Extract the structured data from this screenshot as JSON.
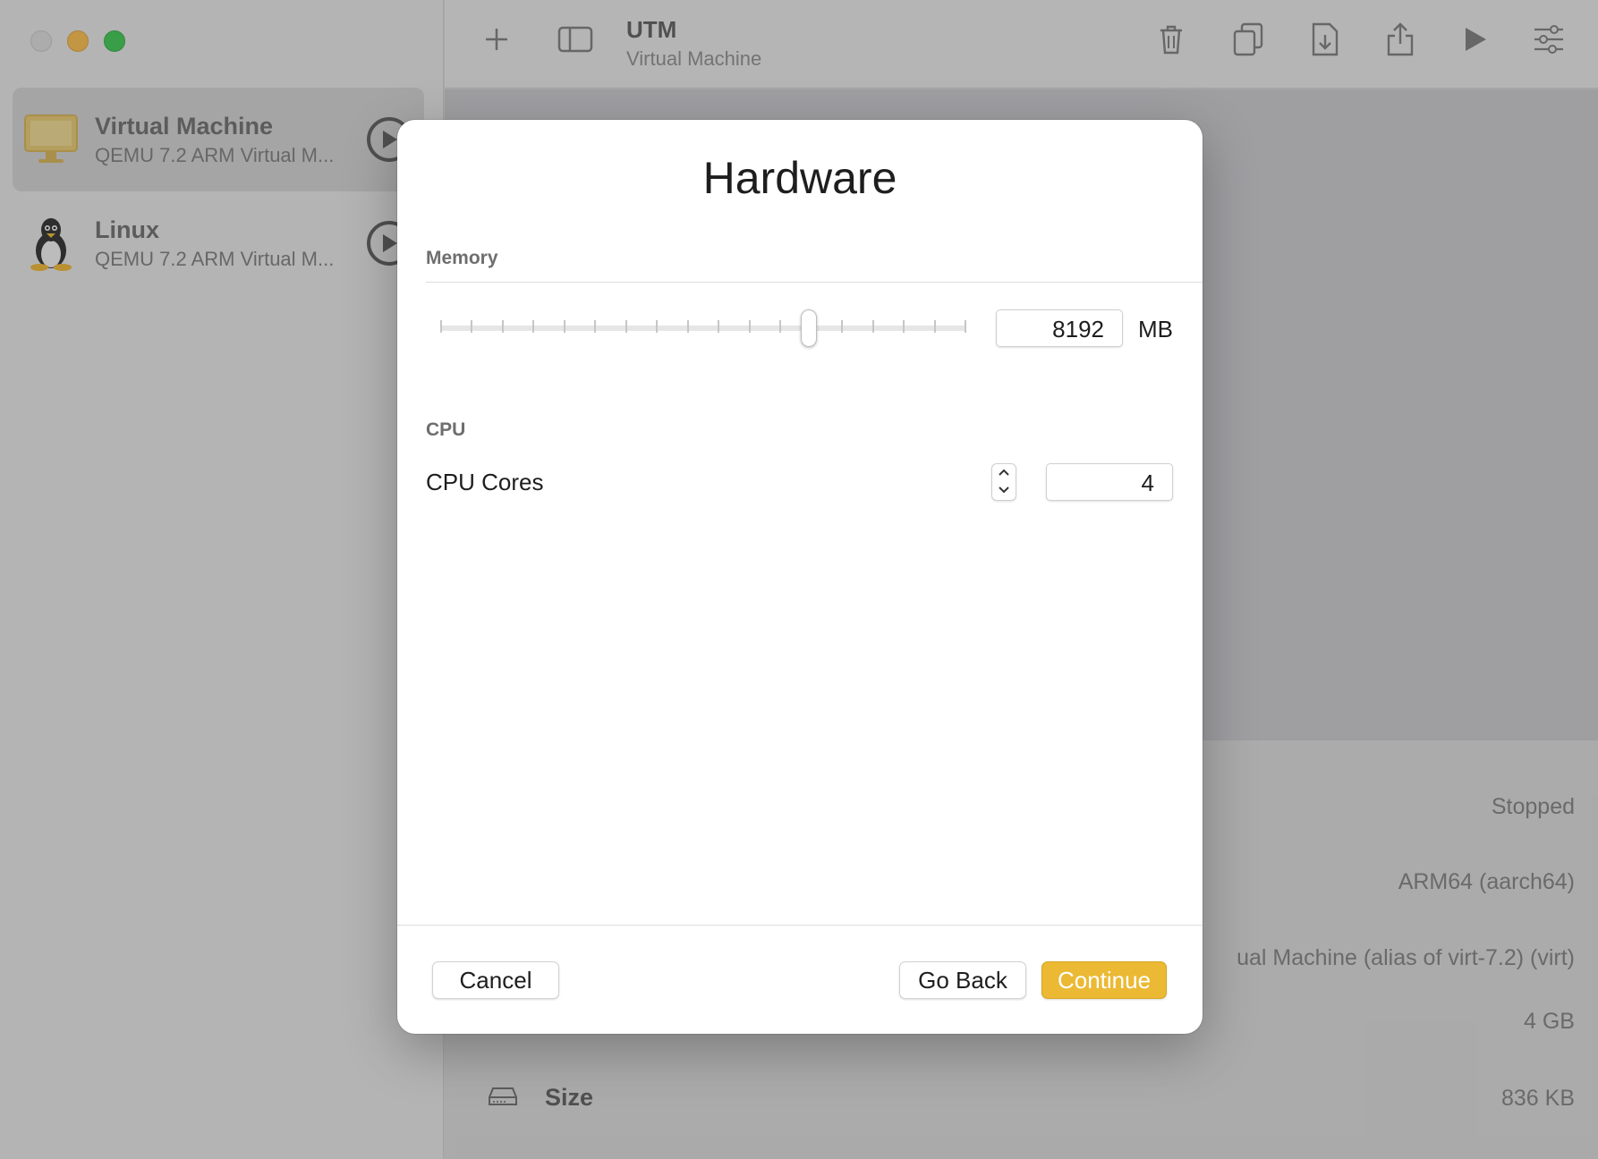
{
  "window": {
    "sidebar": {
      "items": [
        {
          "name": "Virtual Machine",
          "subtitle": "QEMU 7.2 ARM Virtual M...",
          "icon": "monitor-icon",
          "selected": true
        },
        {
          "name": "Linux",
          "subtitle": "QEMU 7.2 ARM Virtual M...",
          "icon": "tux-icon",
          "selected": false
        }
      ]
    },
    "toolbar": {
      "title": "UTM",
      "subtitle": "Virtual Machine",
      "icons": [
        "plus-icon",
        "sidebar-toggle-icon",
        "trash-icon",
        "clone-icon",
        "download-icon",
        "share-icon",
        "play-icon",
        "settings-icon"
      ]
    },
    "details": {
      "status": "Stopped",
      "architecture": "ARM64 (aarch64)",
      "machine": "ual Machine (alias of virt-7.2) (virt)",
      "memory": "4 GB",
      "size_label": "Size",
      "size_value": "836 KB"
    }
  },
  "dialog": {
    "title": "Hardware",
    "memory_section": "Memory",
    "memory_value": "8192",
    "memory_unit": "MB",
    "memory_slider_fraction": 0.7,
    "cpu_section": "CPU",
    "cpu_cores_label": "CPU Cores",
    "cpu_cores_value": "4",
    "buttons": {
      "cancel": "Cancel",
      "go_back": "Go Back",
      "continue": "Continue"
    }
  },
  "colors": {
    "accent": "#ebb934",
    "overlay": "rgba(70,70,70,0.32)"
  }
}
